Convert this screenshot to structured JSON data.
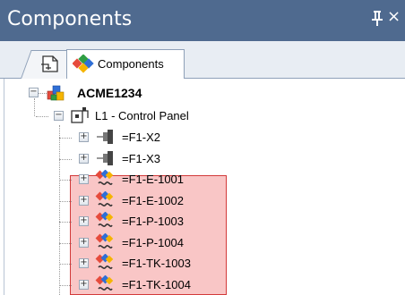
{
  "panel": {
    "title": "Components",
    "pin_glyph": "ᵖ",
    "close_glyph": "×"
  },
  "tabs": [
    {
      "label": "",
      "icon": "document-tree-icon"
    },
    {
      "label": "Components",
      "icon": "components-cubes-icon"
    }
  ],
  "tree": {
    "root": {
      "label": "ACME1234",
      "icon": "project-cubes-icon",
      "expanded": true
    },
    "location": {
      "label": "L1 - Control Panel",
      "icon": "location-icon",
      "expanded": true
    },
    "items": [
      {
        "label": "=F1-X2",
        "icon": "terminal-block-icon",
        "highlighted": false
      },
      {
        "label": "=F1-X3",
        "icon": "terminal-block-icon",
        "highlighted": false
      },
      {
        "label": "=F1-E-1001",
        "icon": "component-device-icon",
        "highlighted": true
      },
      {
        "label": "=F1-E-1002",
        "icon": "component-device-icon",
        "highlighted": true
      },
      {
        "label": "=F1-P-1003",
        "icon": "component-device-icon",
        "highlighted": true
      },
      {
        "label": "=F1-P-1004",
        "icon": "component-device-icon",
        "highlighted": true
      },
      {
        "label": "=F1-TK-1003",
        "icon": "component-device-icon",
        "highlighted": true
      },
      {
        "label": "=F1-TK-1004",
        "icon": "component-device-icon",
        "highlighted": true
      }
    ],
    "expander_collapsed": "+",
    "expander_expanded": "−"
  },
  "colors": {
    "titlebar": "#4f6a8f",
    "highlight_fill": "#f9c6c6",
    "highlight_border": "#d23a3a"
  }
}
